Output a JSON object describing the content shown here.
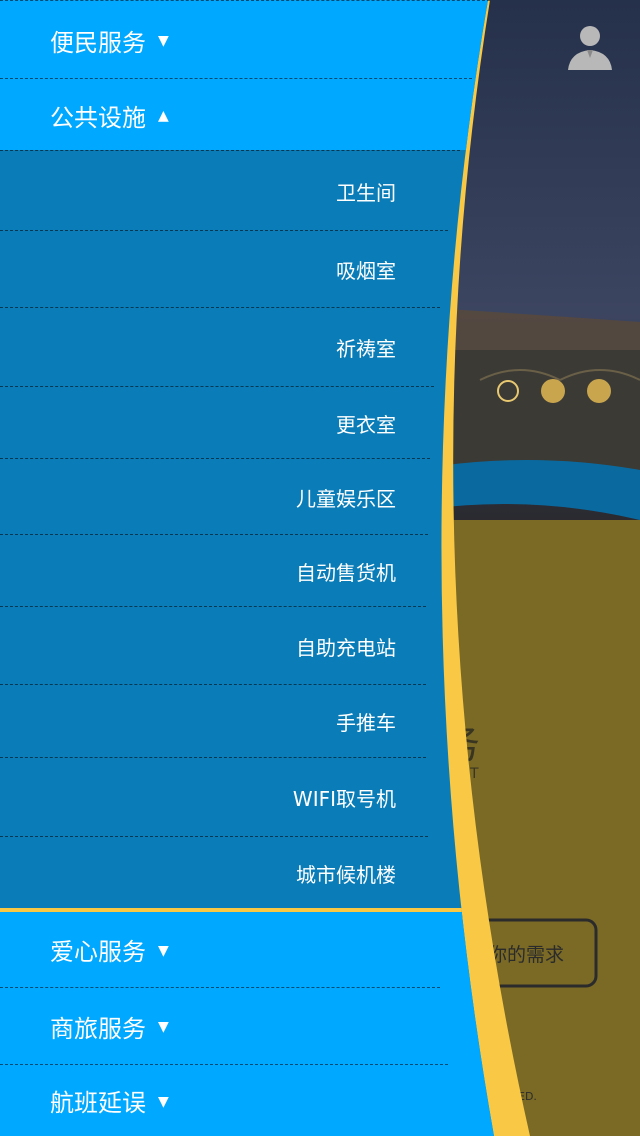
{
  "background": {
    "char_fragment": "务",
    "letter_fragment": "T",
    "button_text": "你的需求",
    "footer_fragment": "ED.",
    "carousel_dots": 3,
    "carousel_active_index": 0
  },
  "menu": {
    "categories": [
      {
        "label": "便民服务",
        "arrow": "▼",
        "expanded": false
      },
      {
        "label": "公共设施",
        "arrow": "▲",
        "expanded": true
      },
      {
        "label": "爱心服务",
        "arrow": "▼",
        "expanded": false
      },
      {
        "label": "商旅服务",
        "arrow": "▼",
        "expanded": false
      },
      {
        "label": "航班延误",
        "arrow": "▼",
        "expanded": false
      }
    ],
    "subitems": [
      "卫生间",
      "吸烟室",
      "祈祷室",
      "更衣室",
      "儿童娱乐区",
      "自动售货机",
      "自助充电站",
      "手推车",
      "WIFI取号机",
      "城市候机楼"
    ]
  },
  "colors": {
    "category_bg": "#00a8ff",
    "subitem_bg": "#0a7db8",
    "curve_yellow": "#f9c845",
    "olive": "#7a6a26",
    "night_sky": "#2c3853"
  },
  "icons": {
    "avatar": "user-avatar-icon",
    "expand": "triangle-down-icon",
    "collapse": "triangle-up-icon"
  }
}
